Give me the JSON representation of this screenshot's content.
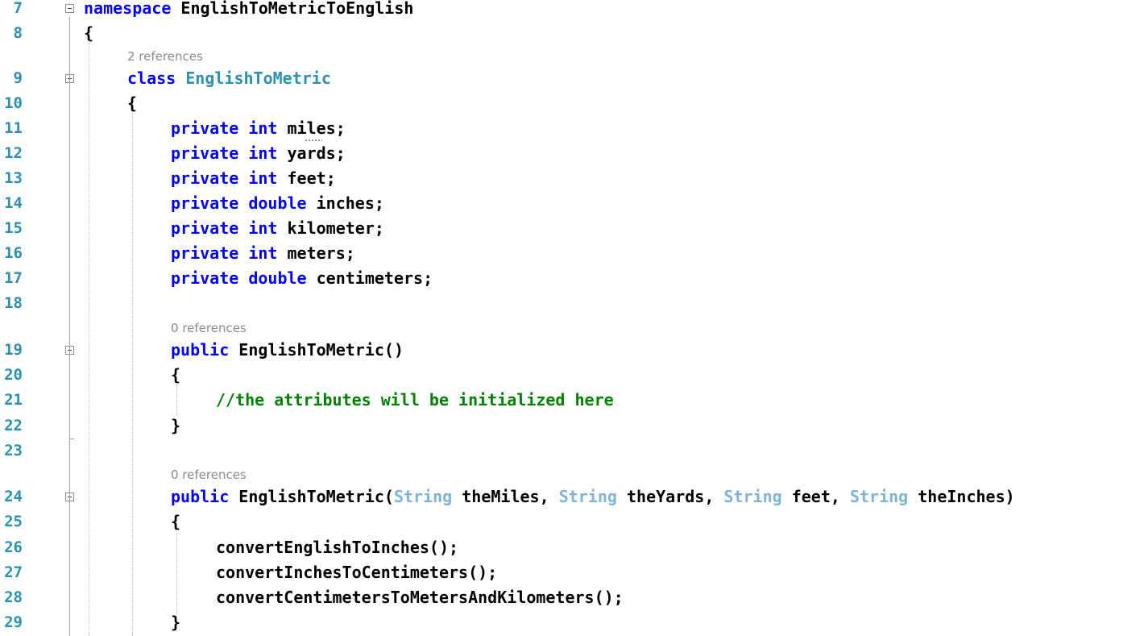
{
  "editor": {
    "lines": [
      {
        "num": "7",
        "text": "namespace EnglishToMetricToEnglish"
      },
      {
        "num": "8",
        "text": "{"
      },
      {
        "num": "9",
        "text": "class EnglishToMetric",
        "codelens": "2 references"
      },
      {
        "num": "10",
        "text": "{"
      },
      {
        "num": "11",
        "text": "private int miles;"
      },
      {
        "num": "12",
        "text": "private int yards;"
      },
      {
        "num": "13",
        "text": "private int feet;"
      },
      {
        "num": "14",
        "text": "private double inches;"
      },
      {
        "num": "15",
        "text": "private int kilometer;"
      },
      {
        "num": "16",
        "text": "private int meters;"
      },
      {
        "num": "17",
        "text": "private double centimeters;"
      },
      {
        "num": "18",
        "text": ""
      },
      {
        "num": "19",
        "text": "public EnglishToMetric()",
        "codelens": "0 references"
      },
      {
        "num": "20",
        "text": "{"
      },
      {
        "num": "21",
        "text": "//the attributes will be initialized here"
      },
      {
        "num": "22",
        "text": "}"
      },
      {
        "num": "23",
        "text": ""
      },
      {
        "num": "24",
        "text": "public EnglishToMetric(String theMiles, String theYards, String feet, String theInches)",
        "codelens": "0 references"
      },
      {
        "num": "25",
        "text": "{"
      },
      {
        "num": "26",
        "text": "convertEnglishToInches();"
      },
      {
        "num": "27",
        "text": "convertInchesToCentimeters();"
      },
      {
        "num": "28",
        "text": "convertCentimetersToMetersAndKilometers();"
      },
      {
        "num": "29",
        "text": "}"
      }
    ],
    "colors": {
      "keyword": "#0000ff",
      "type_name": "#2b91af",
      "string_type": "#7fb4d4",
      "comment": "#008000",
      "line_number": "#2b91af",
      "codelens": "#8a8a8a"
    }
  }
}
